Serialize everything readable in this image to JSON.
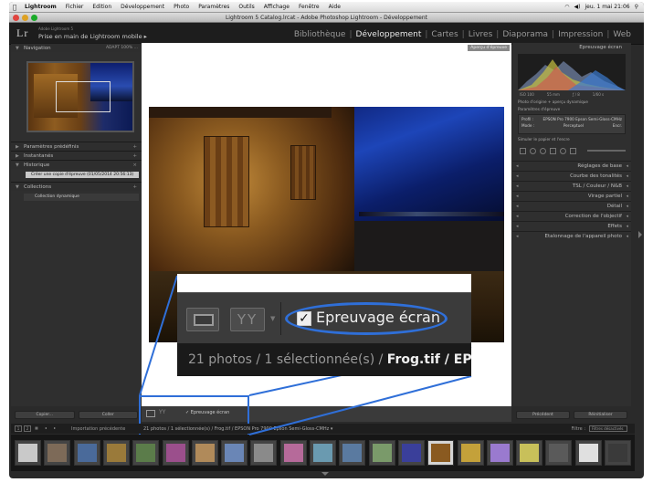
{
  "menubar": {
    "app": "Lightroom",
    "items": [
      "Fichier",
      "Edition",
      "Développement",
      "Photo",
      "Paramètres",
      "Outils",
      "Affichage",
      "Fenêtre",
      "Aide"
    ],
    "clock": "jeu. 1 mai 21:06"
  },
  "window": {
    "title": "Lightroom 5 Catalog.lrcat - Adobe Photoshop Lightroom - Développement"
  },
  "identity": {
    "logo": "Lr",
    "small_text": "Adobe Lightroom 5",
    "big_text": "Prise en main de Lightroom mobile ▸"
  },
  "modules": [
    "Bibliothèque",
    "Développement",
    "Cartes",
    "Livres",
    "Diaporama",
    "Impression",
    "Web"
  ],
  "left_panel": {
    "navigator": {
      "title": "Navigation",
      "options": "ADAPT   100%   ..."
    },
    "sections": [
      "Paramètres prédéfinis",
      "Instantanés",
      "Historique"
    ],
    "history_item": "Créer une copie d'épreuve (01/05/2014 20:56:13)",
    "collections_title": "Collections",
    "collection_item": "Collection dynamique",
    "buttons": [
      "Copier...",
      "Coller"
    ]
  },
  "center": {
    "proof_label": "Aperçu d'épreuve",
    "toolbar_check": "✓ Epreuvage écran"
  },
  "zoom": {
    "check_mark": "✓",
    "check_label": "Epreuvage écran",
    "yy": "YY",
    "status_prefix": "21 photos / 1 sélectionnée(s) / ",
    "status_bold": "Frog.tif / EPSON P"
  },
  "right_panel": {
    "title": "Epreuvage écran",
    "hist_readout": [
      "ISO 100",
      "55 mm",
      "ƒ / 8",
      "1/60 s"
    ],
    "proof_line": "Photo d'origine + aperçu dynamique",
    "profile_title": "Paramètres d'épreuve",
    "profile_row1": [
      "Profil :",
      "EPSON Pro 7900 Epson Semi-Gloss-CMHz"
    ],
    "profile_row2": [
      "Mode :",
      "Perceptuel",
      "Encr."
    ],
    "gamut_line": "Simuler le papier et l'encre",
    "sections": [
      "Réglages de base",
      "Courbe des tonalités",
      "TSL / Couleur / N&B",
      "Virage partiel",
      "Détail",
      "Correction de l'objectif",
      "Effets",
      "Etalonnage de l'appareil photo"
    ],
    "buttons": [
      "Précédent",
      "Réinitialiser"
    ]
  },
  "filmstrip": {
    "page_numbers": [
      "1",
      "2"
    ],
    "path": "Importation précédente",
    "status": "21 photos / 1 sélectionnée(s) / Frog.tif / EPSON Pro 7900 Epson Semi-Gloss-CMHz ▾",
    "filter_label": "Filtre :",
    "filter_value": "Filtres désactivés",
    "thumbnails": [
      {
        "color": "#c9c9c9",
        "selected": false
      },
      {
        "color": "#7d6a58",
        "selected": false
      },
      {
        "color": "#4a6a9a",
        "selected": false
      },
      {
        "color": "#9a7a3a",
        "selected": false
      },
      {
        "color": "#5b7c4a",
        "selected": false
      },
      {
        "color": "#9b4f8c",
        "selected": false
      },
      {
        "color": "#b08a5a",
        "selected": false
      },
      {
        "color": "#6a86b6",
        "selected": false
      },
      {
        "color": "#8a8a8a",
        "selected": false
      },
      {
        "color": "#b66a9a",
        "selected": false
      },
      {
        "color": "#6a9ab0",
        "selected": false
      },
      {
        "color": "#5a7aa0",
        "selected": false
      },
      {
        "color": "#7a9a6a",
        "selected": false
      },
      {
        "color": "#3a3f9a",
        "selected": false
      },
      {
        "color": "#8a5a20",
        "selected": true
      },
      {
        "color": "#c4a13a",
        "selected": false
      },
      {
        "color": "#9a7acf",
        "selected": false
      },
      {
        "color": "#c8c05a",
        "selected": false
      },
      {
        "color": "#5a5a5a",
        "selected": false
      },
      {
        "color": "#e0e0e0",
        "selected": false
      },
      {
        "color": "#3a3a3a",
        "selected": false
      }
    ]
  },
  "colors": {
    "accent_blue": "#2f6fd8"
  }
}
